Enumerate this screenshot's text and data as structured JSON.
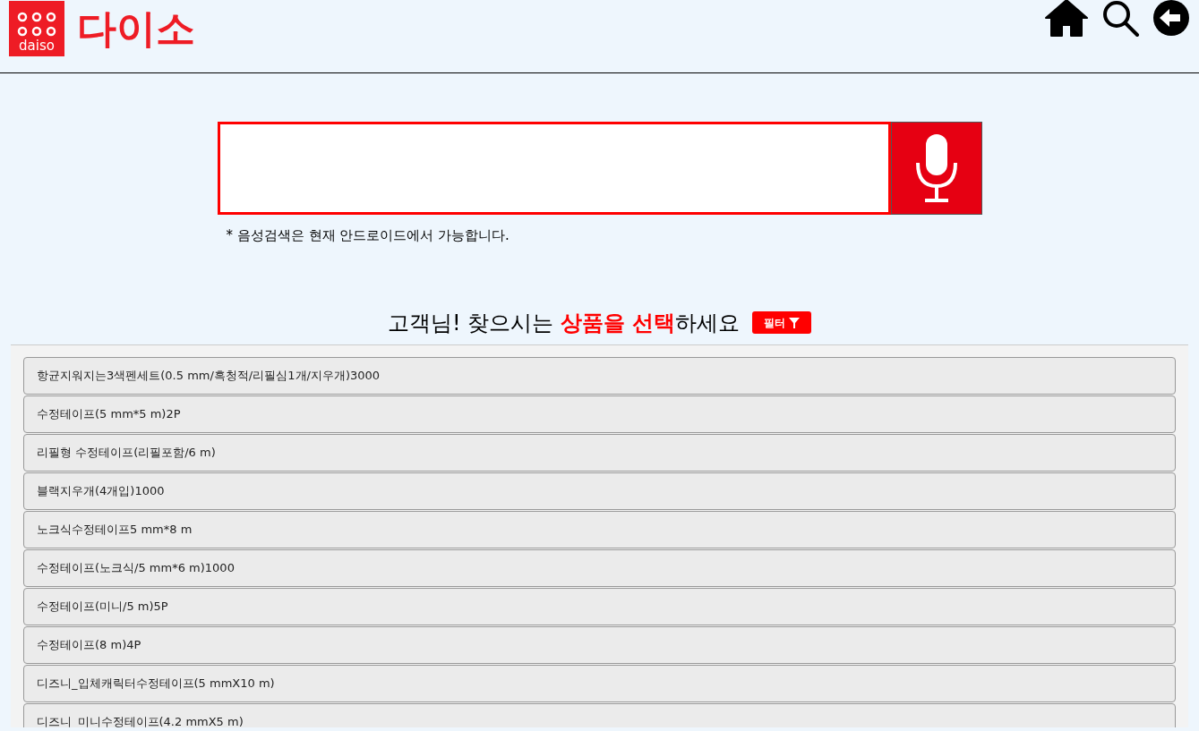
{
  "header": {
    "logo_text": "daiso",
    "brand": "다이소"
  },
  "search": {
    "note": "* 음성검색은 현재 안드로이드에서 가능합니다."
  },
  "heading": "고객님! 찾으시는 **상품을 선택**하세요",
  "filter_button": "필터",
  "products": [
    "항균지워지는3색펜세트(0.5 mm/흑청적/리필심1개/지우개)3000",
    "수정테이프(5 mm*5 m)2P",
    "리필형 수정테이프(리필포함/6 m)",
    "블랙지우개(4개입)1000",
    "노크식수정테이프5 mm*8 m",
    "수정테이프(노크식/5 mm*6 m)1000",
    "수정테이프(미니/5 m)5P",
    "수정테이프(8 m)4P",
    "디즈니_입체캐릭터수정테이프(5 mmX10 m)",
    "디즈니_미니수정테이프(4.2 mmX5 m)"
  ]
}
